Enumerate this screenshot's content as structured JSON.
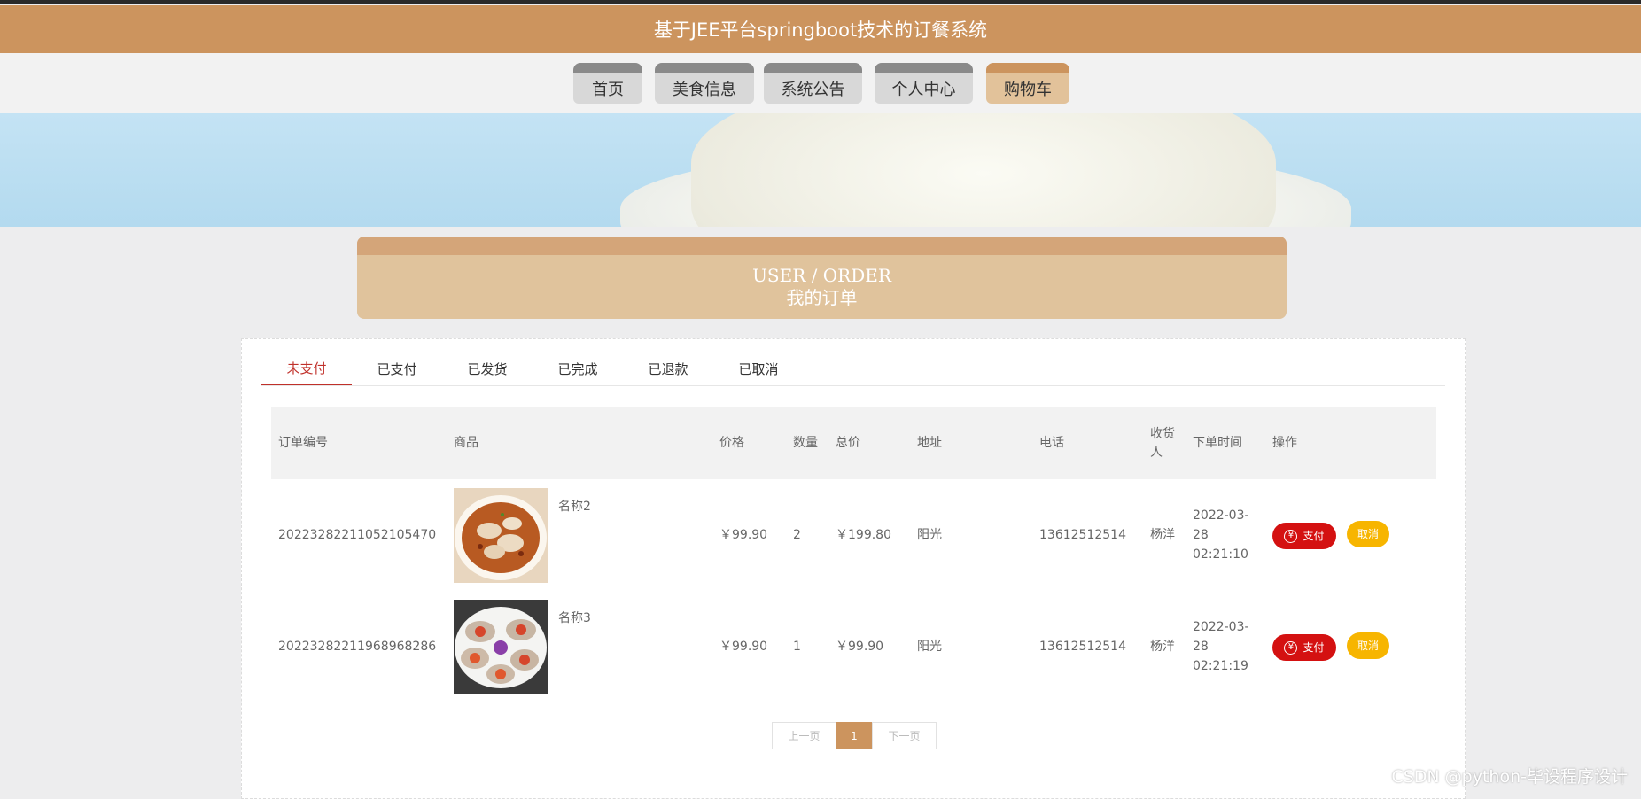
{
  "header": {
    "title": "基于JEE平台springboot技术的订餐系统"
  },
  "nav": {
    "items": [
      {
        "label": "首页"
      },
      {
        "label": "美食信息"
      },
      {
        "label": "系统公告"
      },
      {
        "label": "个人中心"
      },
      {
        "label": "购物车",
        "active": true
      }
    ]
  },
  "section": {
    "title_en": "USER / ORDER",
    "title_cn": "我的订单"
  },
  "tabs": [
    {
      "label": "未支付",
      "active": true
    },
    {
      "label": "已支付"
    },
    {
      "label": "已发货"
    },
    {
      "label": "已完成"
    },
    {
      "label": "已退款"
    },
    {
      "label": "已取消"
    }
  ],
  "table": {
    "headers": {
      "order_no": "订单编号",
      "product": "商品",
      "price": "价格",
      "qty": "数量",
      "total": "总价",
      "address": "地址",
      "phone": "电话",
      "receiver": "收货人",
      "time": "下单时间",
      "action": "操作"
    },
    "rows": [
      {
        "order_no": "20223282211052105470",
        "product_name": "名称2",
        "price": "￥99.90",
        "qty": "2",
        "total": "￥199.80",
        "address": "阳光",
        "phone": "13612512514",
        "receiver": "杨洋",
        "time": "2022-03-28 02:21:10",
        "pay_label": "支付",
        "cancel_label": "取消"
      },
      {
        "order_no": "20223282211968968286",
        "product_name": "名称3",
        "price": "￥99.90",
        "qty": "1",
        "total": "￥99.90",
        "address": "阳光",
        "phone": "13612512514",
        "receiver": "杨洋",
        "time": "2022-03-28 02:21:19",
        "pay_label": "支付",
        "cancel_label": "取消"
      }
    ]
  },
  "pager": {
    "prev": "上一页",
    "current": "1",
    "next": "下一页"
  },
  "watermark": "CSDN @python-毕设程序设计",
  "colors": {
    "brand": "#cc945e",
    "pay": "#d41111",
    "cancel": "#f7b500",
    "active_tab": "#c0302a"
  }
}
